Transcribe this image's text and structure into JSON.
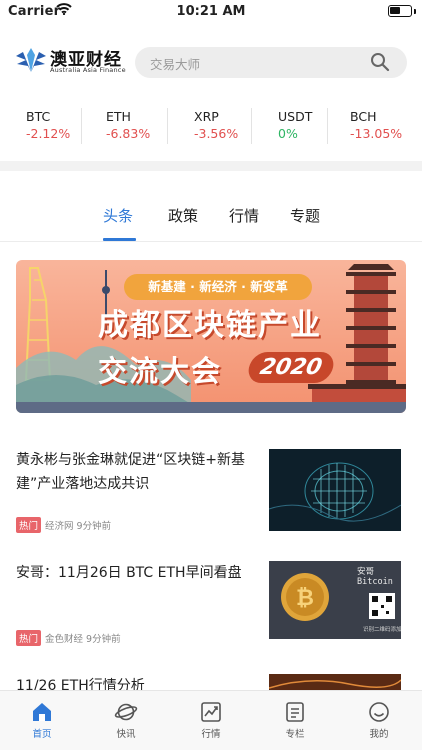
{
  "status_bar": {
    "carrier": "Carrier",
    "time": "10:21 AM",
    "battery_level": 0.55
  },
  "header": {
    "logo_name": "澳亚财经",
    "logo_subtitle": "Australia Asia Finance",
    "search_placeholder": "交易大师"
  },
  "ticker": [
    {
      "symbol": "BTC",
      "change": "-2.12%",
      "color": "#e1504f"
    },
    {
      "symbol": "ETH",
      "change": "-6.83%",
      "color": "#e1504f"
    },
    {
      "symbol": "XRP",
      "change": "-3.56%",
      "color": "#e1504f"
    },
    {
      "symbol": "USDT",
      "change": "0%",
      "color": "#2fb564"
    },
    {
      "symbol": "BCH",
      "change": "-13.05%",
      "color": "#e1504f"
    }
  ],
  "tabs": [
    {
      "label": "头条",
      "active": true
    },
    {
      "label": "政策",
      "active": false
    },
    {
      "label": "行情",
      "active": false
    },
    {
      "label": "专题",
      "active": false
    }
  ],
  "banner": {
    "tagline": "新基建 · 新经济 · 新变革",
    "title": "成都区块链产业",
    "subtitle": "交流大会",
    "year": "2020"
  },
  "news": [
    {
      "title": "黄永彬与张金琳就促进“区块链+新基建”产业落地达成共识",
      "badge": "热门",
      "source": "经济网",
      "time": "9分钟前"
    },
    {
      "title": "安哥：11月26日 BTC ETH早间看盘",
      "badge": "热门",
      "source": "金色财经",
      "time": "9分钟前",
      "thumb_caption": "安哥Bitcoin",
      "thumb_note": "识别二维码添加"
    },
    {
      "title": "11/26 ETH行情分析"
    }
  ],
  "bottom_nav": [
    {
      "label": "首页",
      "icon": "home-icon",
      "active": true
    },
    {
      "label": "快讯",
      "icon": "planet-icon",
      "active": false
    },
    {
      "label": "行情",
      "icon": "chart-icon",
      "active": false
    },
    {
      "label": "专栏",
      "icon": "document-icon",
      "active": false
    },
    {
      "label": "我的",
      "icon": "smile-icon",
      "active": false
    }
  ],
  "colors": {
    "accent": "#2f78d6",
    "down": "#e1504f",
    "up": "#2fb564",
    "hot": "#e8656a"
  }
}
